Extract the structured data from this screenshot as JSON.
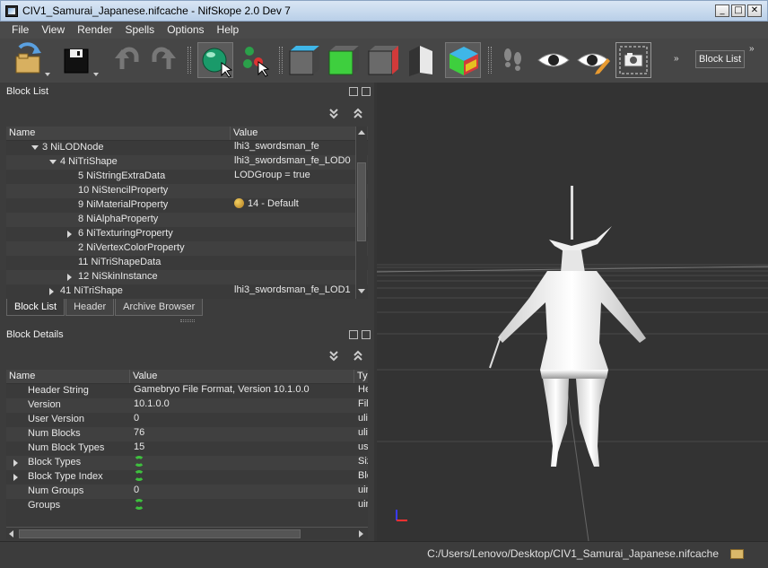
{
  "window": {
    "title": "CIV1_Samurai_Japanese.nifcache - NifSkope 2.0 Dev 7",
    "minimize": "_",
    "maximize": "□",
    "close": "✕"
  },
  "menu": [
    "File",
    "View",
    "Render",
    "Spells",
    "Options",
    "Help"
  ],
  "toolbar": {
    "block_list_label": "Block List",
    "more_glyph": "»",
    "icons": [
      "open-icon",
      "save-icon",
      "undo-icon",
      "redo-icon",
      "select-object-icon",
      "select-vertex-icon",
      "view-top-icon",
      "view-front-icon",
      "view-side-icon",
      "view-user-icon",
      "view-walk-icon",
      "footsteps-icon",
      "eye-icon",
      "eye-edit-icon",
      "screenshot-icon"
    ],
    "cube_colors": {
      "top": "#3fb6e8",
      "front": "#3ecf3e",
      "side": "#d23a3a"
    }
  },
  "block_list": {
    "title": "Block List",
    "columns": [
      "Name",
      "Value"
    ],
    "rows": [
      {
        "name": "3 NiLODNode",
        "value": "lhi3_swordsman_fe",
        "indent": 1,
        "expander": "down"
      },
      {
        "name": "4 NiTriShape",
        "value": "lhi3_swordsman_fe_LOD0",
        "indent": 2,
        "expander": "down"
      },
      {
        "name": "5 NiStringExtraData",
        "value": "LODGroup = true",
        "indent": 3,
        "expander": ""
      },
      {
        "name": "10 NiStencilProperty",
        "value": "",
        "indent": 3,
        "expander": ""
      },
      {
        "name": "9 NiMaterialProperty",
        "value": "14 - Default",
        "indent": 3,
        "expander": "",
        "value_icon": "palette-icon"
      },
      {
        "name": "8 NiAlphaProperty",
        "value": "",
        "indent": 3,
        "expander": ""
      },
      {
        "name": "6 NiTexturingProperty",
        "value": "",
        "indent": 3,
        "expander": "right"
      },
      {
        "name": "2 NiVertexColorProperty",
        "value": "",
        "indent": 3,
        "expander": ""
      },
      {
        "name": "11 NiTriShapeData",
        "value": "",
        "indent": 3,
        "expander": ""
      },
      {
        "name": "12 NiSkinInstance",
        "value": "",
        "indent": 3,
        "expander": "right"
      },
      {
        "name": "41 NiTriShape",
        "value": "lhi3_swordsman_fe_LOD1",
        "indent": 2,
        "expander": "right"
      }
    ],
    "tabs": [
      "Block List",
      "Header",
      "Archive Browser"
    ],
    "active_tab": "Block List"
  },
  "block_details": {
    "title": "Block Details",
    "columns": [
      "Name",
      "Value",
      "Typ"
    ],
    "rows": [
      {
        "name": "Header String",
        "value": "Gamebryo File Format, Version 10.1.0.0",
        "type": "He",
        "expander": ""
      },
      {
        "name": "Version",
        "value": "10.1.0.0",
        "type": "File",
        "expander": ""
      },
      {
        "name": "User Version",
        "value": "0",
        "type": "ulit",
        "expander": ""
      },
      {
        "name": "Num Blocks",
        "value": "76",
        "type": "ulit",
        "expander": ""
      },
      {
        "name": "Num Block Types",
        "value": "15",
        "type": "ush",
        "expander": ""
      },
      {
        "name": "Block Types",
        "value": "",
        "type": "Siz",
        "expander": "right",
        "value_icon": "refresh-icon"
      },
      {
        "name": "Block Type Index",
        "value": "",
        "type": "Blo",
        "expander": "right",
        "value_icon": "refresh-icon"
      },
      {
        "name": "Num Groups",
        "value": "0",
        "type": "uin",
        "expander": ""
      },
      {
        "name": "Groups",
        "value": "",
        "type": "uin",
        "expander": "",
        "value_icon": "refresh-icon"
      }
    ]
  },
  "status": {
    "path": "C:/Users/Lenovo/Desktop/CIV1_Samurai_Japanese.nifcache"
  }
}
